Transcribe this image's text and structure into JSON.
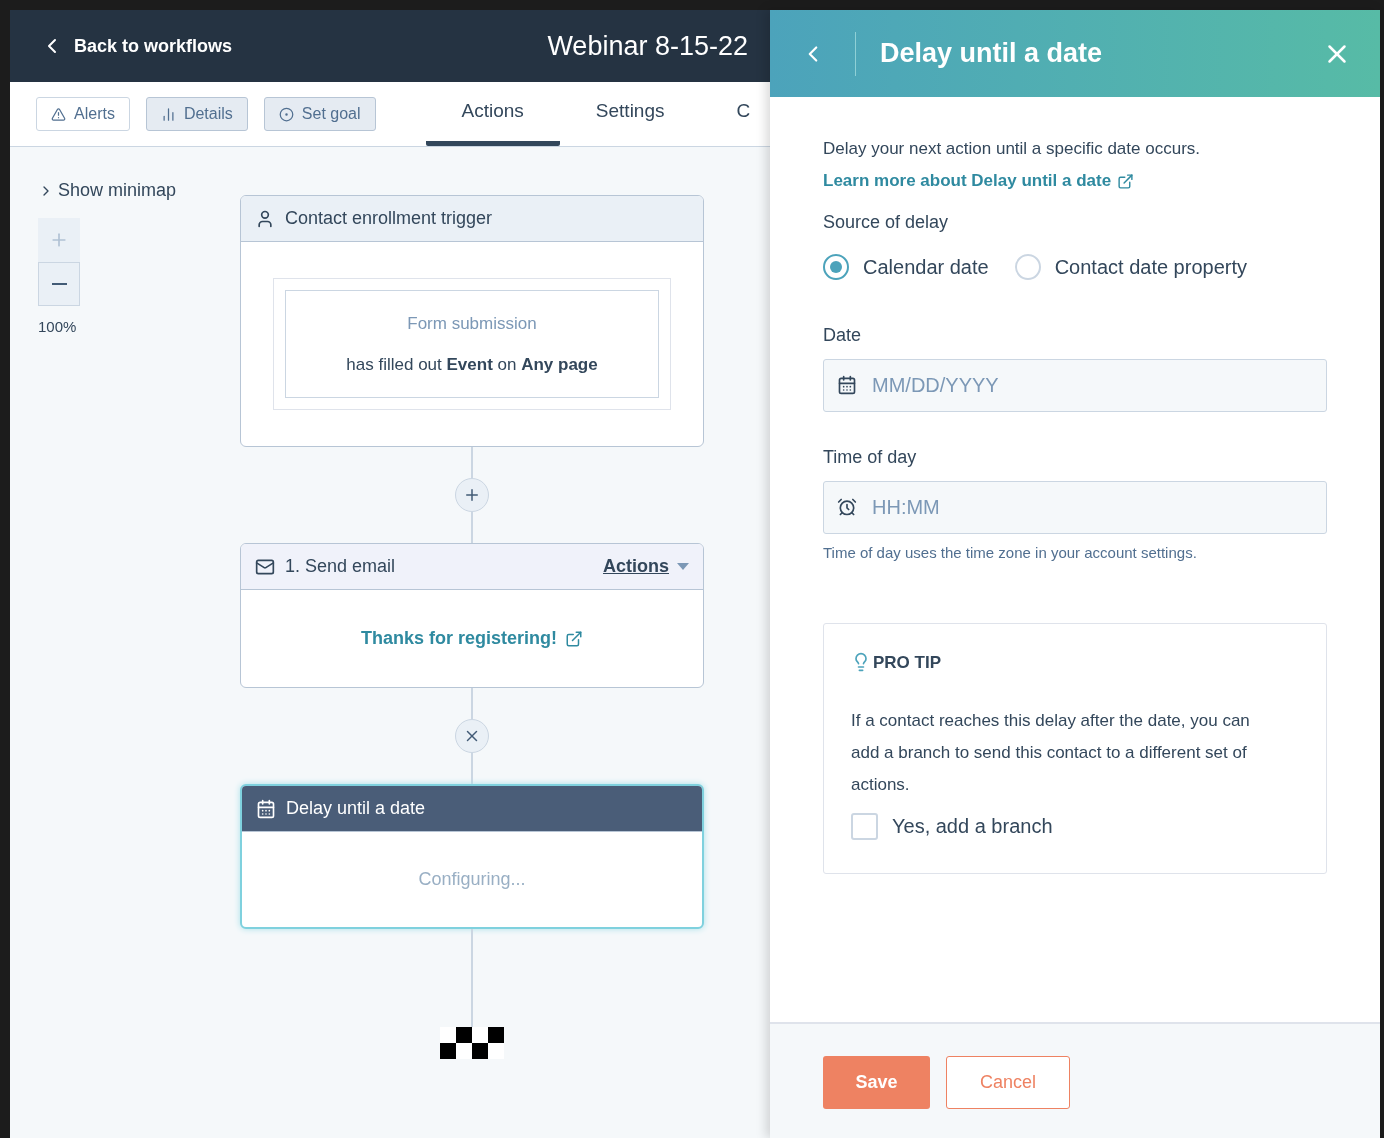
{
  "header": {
    "back_label": "Back to workflows",
    "title": "Webinar 8-15-22"
  },
  "toolbar": {
    "buttons": [
      {
        "label": "Alerts",
        "kind": "alert",
        "shaded": false
      },
      {
        "label": "Details",
        "kind": "chart",
        "shaded": true
      },
      {
        "label": "Set goal",
        "kind": "goal",
        "shaded": true
      }
    ],
    "tabs": [
      {
        "label": "Actions",
        "selected": true
      },
      {
        "label": "Settings",
        "selected": false
      },
      {
        "label": "C",
        "selected": false
      }
    ]
  },
  "canvas": {
    "minimap_label": "Show minimap",
    "zoom_in_disabled": true,
    "zoom": "100%",
    "nodes": [
      {
        "kind": "trigger",
        "title": "Contact enrollment trigger",
        "filter_title": "Form submission",
        "filter_text": "has filled out **Event** on **Any page**",
        "selected": false
      },
      {
        "kind": "email",
        "title": "1. Send email",
        "menu": "Actions",
        "link": "Thanks for registering!",
        "selected": false
      },
      {
        "kind": "delay",
        "title": "Delay until a date",
        "status": "Configuring...",
        "selected": true
      }
    ],
    "connectors": [
      {
        "kind": "add"
      },
      {
        "kind": "remove"
      }
    ]
  },
  "panel": {
    "title": "Delay until a date",
    "description": "Delay your next action until a specific date occurs.",
    "learn_link": "Learn more about Delay until a date",
    "source_label": "Source of delay",
    "sources": [
      {
        "label": "Calendar date",
        "selected": true
      },
      {
        "label": "Contact date property",
        "selected": false
      }
    ],
    "date_label": "Date",
    "date_placeholder": "MM/DD/YYYY",
    "time_label": "Time of day",
    "time_placeholder": "HH:MM",
    "time_hint": "Time of day uses the time zone in your account settings.",
    "tip_title": "PRO TIP",
    "tip_text": "If a contact reaches this delay after the date, you can add a branch to send this contact to a different set of actions.",
    "branch": {
      "label": "Yes, add a branch",
      "checked": false
    },
    "save": "Save",
    "cancel": "Cancel"
  }
}
